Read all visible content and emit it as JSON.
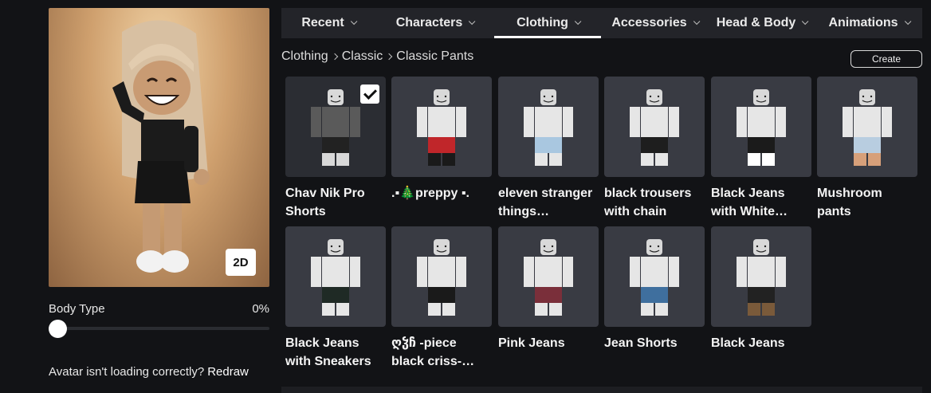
{
  "avatar": {
    "view_toggle_label": "2D",
    "body_type_label": "Body Type",
    "body_type_value": "0%",
    "body_type_level": 0,
    "issue_text": "Avatar isn't loading correctly?",
    "redraw_label": "Redraw"
  },
  "tabs": [
    {
      "label": "Recent",
      "active": false
    },
    {
      "label": "Characters",
      "active": false
    },
    {
      "label": "Clothing",
      "active": true
    },
    {
      "label": "Accessories",
      "active": false
    },
    {
      "label": "Head & Body",
      "active": false
    },
    {
      "label": "Animations",
      "active": false
    }
  ],
  "breadcrumb": [
    "Clothing",
    "Classic",
    "Classic Pants"
  ],
  "create_label": "Create",
  "items": [
    {
      "name": "Chav Nik Pro Shorts",
      "selected": true,
      "top": "#5a5a5a",
      "pants": "#222222",
      "pants2": "#d8d8d8"
    },
    {
      "name": ".▪︎🎄preppy ▪︎.",
      "selected": false,
      "top": "#e6e6e6",
      "pants": "#c0262a",
      "pants2": "#1a1a1a"
    },
    {
      "name": "eleven stranger things matching...",
      "selected": false,
      "top": "#e6e6e6",
      "pants": "#a9c7e0",
      "pants2": "#e6e6e6"
    },
    {
      "name": "black trousers with chain",
      "selected": false,
      "top": "#e6e6e6",
      "pants": "#1e1e1e",
      "pants2": "#e6e6e6"
    },
    {
      "name": "Black Jeans with White Shoes",
      "selected": false,
      "top": "#e6e6e6",
      "pants": "#1b1b1b",
      "pants2": "#ffffff"
    },
    {
      "name": "Mushroom pants",
      "selected": false,
      "top": "#e6e6e6",
      "pants": "#b8cde0",
      "pants2": "#d7a07a"
    },
    {
      "name": "Black Jeans with Sneakers",
      "selected": false,
      "top": "#e6e6e6",
      "pants": "#1f2a25",
      "pants2": "#e6e6e6"
    },
    {
      "name": "ღჴჩ -piece black criss-cross swi...",
      "selected": false,
      "top": "#e6e6e6",
      "pants": "#1a1a1a",
      "pants2": "#e6e6e6"
    },
    {
      "name": "Pink Jeans",
      "selected": false,
      "top": "#e6e6e6",
      "pants": "#7a2f3a",
      "pants2": "#e6e6e6"
    },
    {
      "name": "Jean Shorts",
      "selected": false,
      "top": "#e6e6e6",
      "pants": "#3f6f9e",
      "pants2": "#e6e6e6"
    },
    {
      "name": "Black Jeans",
      "selected": false,
      "top": "#e6e6e6",
      "pants": "#222222",
      "pants2": "#7a5a3a"
    }
  ]
}
